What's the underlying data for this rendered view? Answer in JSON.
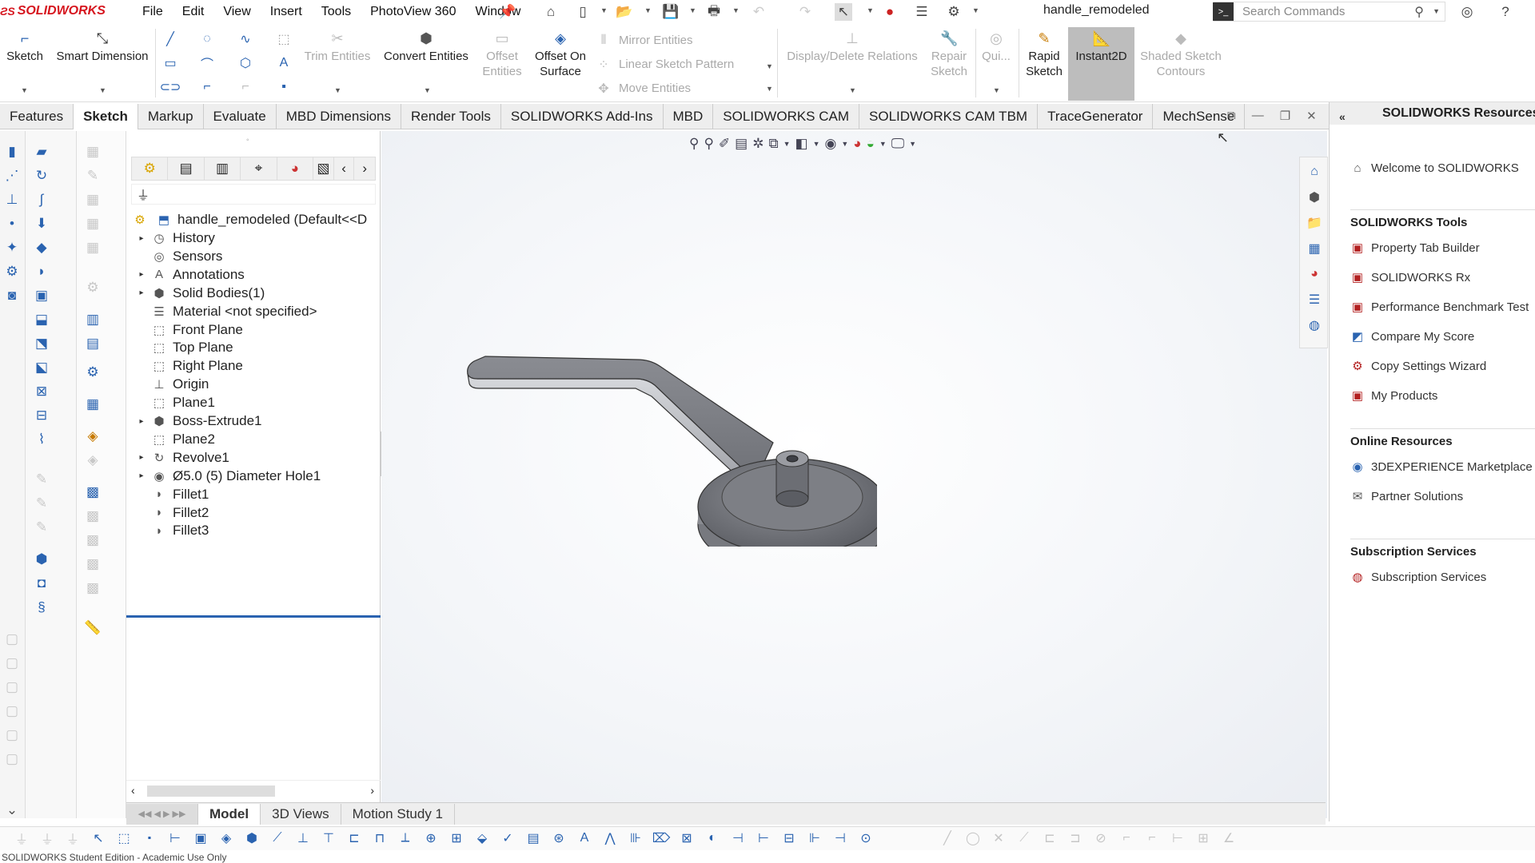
{
  "app": {
    "brand": "SOLIDWORKS",
    "brand_color": "#d6151e",
    "accent": "#2a63b0"
  },
  "menu": [
    "File",
    "Edit",
    "View",
    "Insert",
    "Tools",
    "PhotoView 360",
    "Window"
  ],
  "document_title": "handle_remodeled",
  "search": {
    "placeholder": "Search Commands"
  },
  "command_manager": {
    "sketch": "Sketch",
    "smart_dimension": "Smart Dimension",
    "trim_entities": "Trim Entities",
    "convert_entities": "Convert Entities",
    "offset_entities": "Offset Entities",
    "offset_on_surface": "Offset On Surface",
    "mirror_entities": "Mirror Entities",
    "linear_sketch_pattern": "Linear Sketch Pattern",
    "move_entities": "Move Entities",
    "display_delete_relations": "Display/Delete Relations",
    "repair_sketch": "Repair Sketch",
    "quick_snaps": "Qui...",
    "rapid_sketch": "Rapid Sketch",
    "instant2d": "Instant2D",
    "shaded_sketch_contours": "Shaded Sketch Contours"
  },
  "tabs": [
    {
      "label": "Features",
      "active": false
    },
    {
      "label": "Sketch",
      "active": true
    },
    {
      "label": "Markup",
      "active": false
    },
    {
      "label": "Evaluate",
      "active": false
    },
    {
      "label": "MBD Dimensions",
      "active": false
    },
    {
      "label": "Render Tools",
      "active": false
    },
    {
      "label": "SOLIDWORKS Add-Ins",
      "active": false
    },
    {
      "label": "MBD",
      "active": false
    },
    {
      "label": "SOLIDWORKS CAM",
      "active": false
    },
    {
      "label": "SOLIDWORKS CAM TBM",
      "active": false
    },
    {
      "label": "TraceGenerator",
      "active": false
    },
    {
      "label": "MechSense",
      "active": false
    }
  ],
  "feature_tree": {
    "root": "handle_remodeled  (Default<<D",
    "items": [
      {
        "label": "History",
        "expandable": true,
        "icon": "history-icon"
      },
      {
        "label": "Sensors",
        "expandable": false,
        "icon": "sensor-icon"
      },
      {
        "label": "Annotations",
        "expandable": true,
        "icon": "annotation-icon"
      },
      {
        "label": "Solid Bodies(1)",
        "expandable": true,
        "icon": "solid-bodies-icon"
      },
      {
        "label": "Material <not specified>",
        "expandable": false,
        "icon": "material-icon"
      },
      {
        "label": "Front Plane",
        "expandable": false,
        "icon": "plane-icon"
      },
      {
        "label": "Top Plane",
        "expandable": false,
        "icon": "plane-icon"
      },
      {
        "label": "Right Plane",
        "expandable": false,
        "icon": "plane-icon"
      },
      {
        "label": "Origin",
        "expandable": false,
        "icon": "origin-icon"
      },
      {
        "label": "Plane1",
        "expandable": false,
        "icon": "plane-icon"
      },
      {
        "label": "Boss-Extrude1",
        "expandable": true,
        "icon": "extrude-icon"
      },
      {
        "label": "Plane2",
        "expandable": false,
        "icon": "plane-icon"
      },
      {
        "label": "Revolve1",
        "expandable": true,
        "icon": "revolve-icon"
      },
      {
        "label": "Ø5.0 (5) Diameter Hole1",
        "expandable": true,
        "icon": "hole-icon"
      },
      {
        "label": "Fillet1",
        "expandable": false,
        "icon": "fillet-icon"
      },
      {
        "label": "Fillet2",
        "expandable": false,
        "icon": "fillet-icon"
      },
      {
        "label": "Fillet3",
        "expandable": false,
        "icon": "fillet-icon"
      }
    ]
  },
  "bottom_tabs": [
    {
      "label": "Model",
      "active": true
    },
    {
      "label": "3D Views",
      "active": false
    },
    {
      "label": "Motion Study 1",
      "active": false
    }
  ],
  "task_pane": {
    "title": "SOLIDWORKS Resources",
    "welcome": "Welcome to SOLIDWORKS",
    "tools_heading": "SOLIDWORKS Tools",
    "tools": [
      "Property Tab Builder",
      "SOLIDWORKS Rx",
      "Performance Benchmark Test",
      "Compare My Score",
      "Copy Settings Wizard",
      "My Products"
    ],
    "online_heading": "Online Resources",
    "online": [
      "3DEXPERIENCE Marketplace",
      "Partner Solutions"
    ],
    "subscription_heading": "Subscription Services",
    "subscription": [
      "Subscription Services"
    ]
  },
  "status_bar": "SOLIDWORKS Student Edition - Academic Use Only"
}
